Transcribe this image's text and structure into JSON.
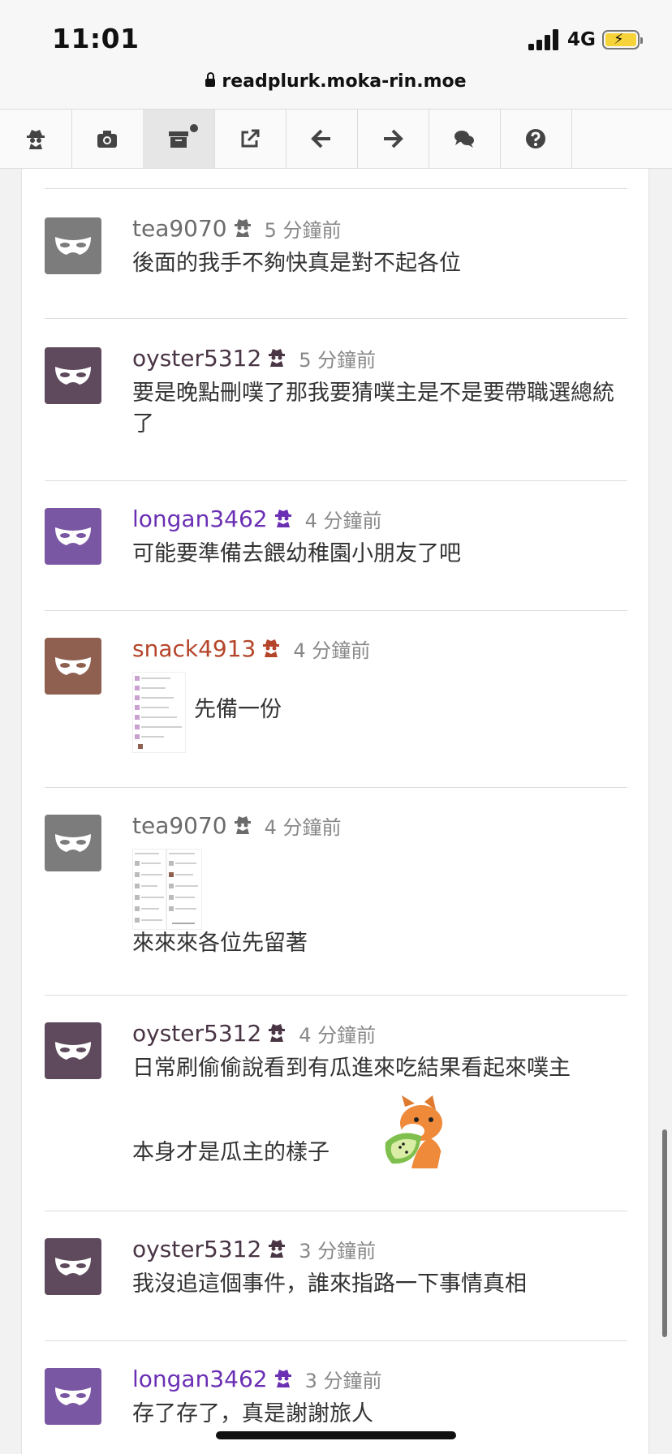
{
  "status": {
    "time": "11:01",
    "network": "4G"
  },
  "browser": {
    "url": "readplurk.moka-rin.moe"
  },
  "toolbar": {
    "buttons": [
      {
        "name": "anonymous-icon"
      },
      {
        "name": "camera-icon"
      },
      {
        "name": "archive-icon"
      },
      {
        "name": "external-link-icon"
      },
      {
        "name": "arrow-left-icon"
      },
      {
        "name": "arrow-right-icon"
      },
      {
        "name": "comments-icon"
      },
      {
        "name": "help-icon"
      }
    ]
  },
  "colors": {
    "grey_user": "#6b6b6b",
    "dark_user": "#4a3545",
    "purple_user": "#6a2fb3",
    "orange_user": "#b5452a",
    "grey_avatar": "#7c7c7c",
    "dark_avatar": "#5e4a5c",
    "purple_avatar": "#7a57a3",
    "orange_avatar": "#8f6050"
  },
  "responses": [
    {
      "user": "tea9070",
      "time": "5 分鐘前",
      "text": "後面的我手不夠快真是對不起各位"
    },
    {
      "user": "oyster5312",
      "time": "5 分鐘前",
      "text": "要是晚點刪噗了那我要猜噗主是不是要帶職選總統了"
    },
    {
      "user": "longan3462",
      "time": "4 分鐘前",
      "text": "可能要準備去餵幼稚園小朋友了吧"
    },
    {
      "user": "snack4913",
      "time": "4 分鐘前",
      "text": "先備一份"
    },
    {
      "user": "tea9070",
      "time": "4 分鐘前",
      "text": "來來來各位先留著"
    },
    {
      "user": "oyster5312",
      "time": "4 分鐘前",
      "text_line1": "日常刷偷偷說看到有瓜進來吃結果看起來噗主",
      "text_line2": "本身才是瓜主的樣子"
    },
    {
      "user": "oyster5312",
      "time": "3 分鐘前",
      "text": "我沒追這個事件，誰來指路一下事情真相"
    },
    {
      "user": "longan3462",
      "time": "3 分鐘前",
      "text": "存了存了，真是謝謝旅人"
    }
  ]
}
